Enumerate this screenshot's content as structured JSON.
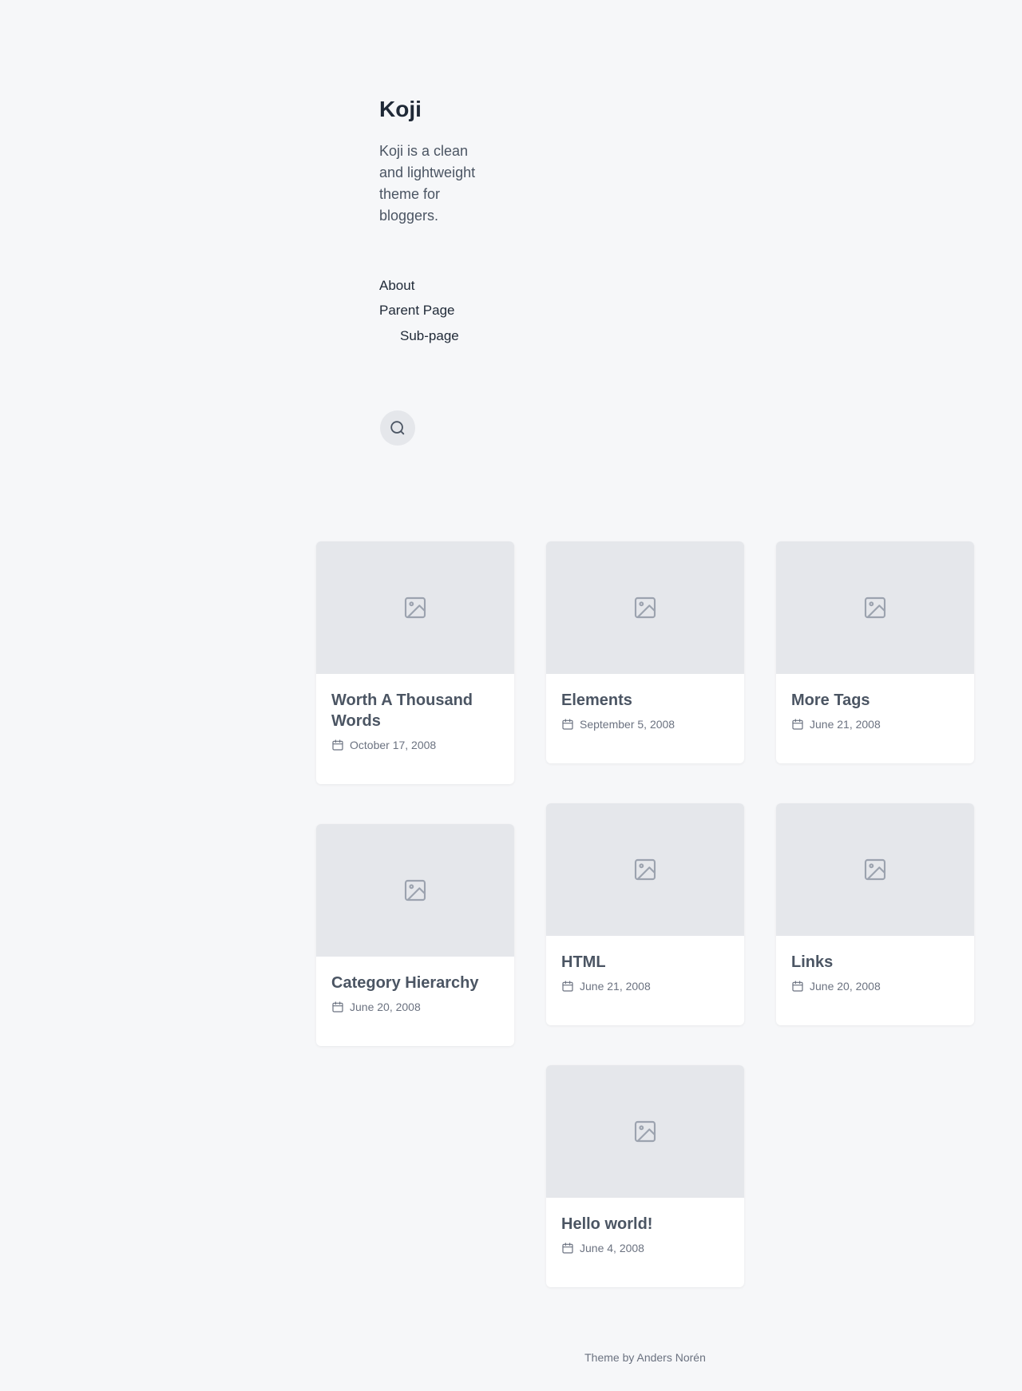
{
  "site": {
    "title": "Koji",
    "description": "Koji is a clean and lightweight theme for bloggers."
  },
  "menu": {
    "items": [
      {
        "label": "About"
      },
      {
        "label": "Parent Page"
      },
      {
        "label": "Sub-page"
      }
    ]
  },
  "search": {
    "icon": "search-icon"
  },
  "posts": [
    {
      "title": "Worth A Thousand Words",
      "date": "October 17, 2008",
      "thumbnail_icon": "image-icon",
      "date_icon": "calendar-icon"
    },
    {
      "title": "Elements",
      "date": "September 5, 2008",
      "thumbnail_icon": "image-icon",
      "date_icon": "calendar-icon"
    },
    {
      "title": "More Tags",
      "date": "June 21, 2008",
      "thumbnail_icon": "image-icon",
      "date_icon": "calendar-icon"
    },
    {
      "title": "Category Hierarchy",
      "date": "June 20, 2008",
      "thumbnail_icon": "image-icon",
      "date_icon": "calendar-icon"
    },
    {
      "title": "HTML",
      "date": "June 21, 2008",
      "thumbnail_icon": "image-icon",
      "date_icon": "calendar-icon"
    },
    {
      "title": "Links",
      "date": "June 20, 2008",
      "thumbnail_icon": "image-icon",
      "date_icon": "calendar-icon"
    },
    {
      "title": "Hello world!",
      "date": "June 4, 2008",
      "thumbnail_icon": "image-icon",
      "date_icon": "calendar-icon"
    }
  ],
  "footer": {
    "credit": "Theme by Anders Norén"
  },
  "colors": {
    "background": "#f6f7f9",
    "card": "#ffffff",
    "thumbnail": "#e5e7eb",
    "text_primary": "#1f2937",
    "text_secondary": "#4b5563",
    "text_muted": "#6b7280"
  }
}
